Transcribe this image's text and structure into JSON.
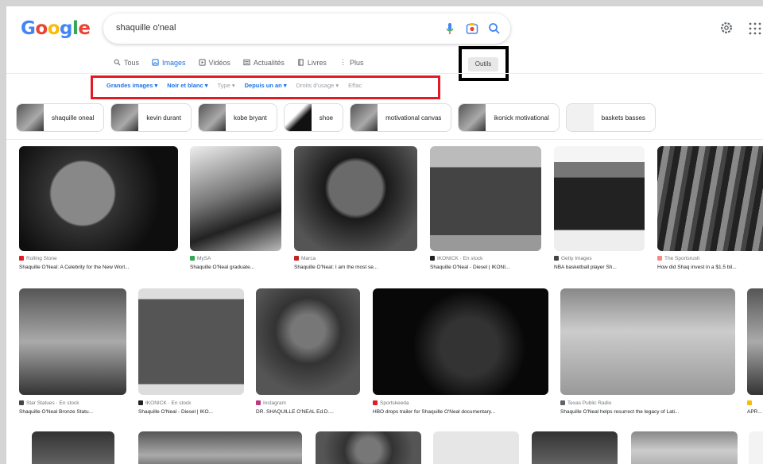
{
  "search": {
    "query": "shaquille o'neal"
  },
  "tabs": [
    {
      "label": "Tous",
      "icon": "search-icon",
      "active": false
    },
    {
      "label": "Images",
      "icon": "image-icon",
      "active": true
    },
    {
      "label": "Vidéos",
      "icon": "video-icon",
      "active": false
    },
    {
      "label": "Actualités",
      "icon": "news-icon",
      "active": false
    },
    {
      "label": "Livres",
      "icon": "book-icon",
      "active": false
    },
    {
      "label": "Plus",
      "icon": "more-icon",
      "active": false
    }
  ],
  "tools_label": "Outils",
  "filters": [
    "Grandes images",
    "Noir et blanc",
    "Type",
    "Depuis un an",
    "Droits d'usage",
    "Effac"
  ],
  "chips": [
    "shaquille oneal",
    "kevin durant",
    "kobe bryant",
    "shoe",
    "motivational canvas",
    "ikonick motivational",
    "baskets basses"
  ],
  "results_row1": [
    {
      "source": "Rolling Stone",
      "title": "Shaquille O'Neal: A Celebrity for the New Worl..."
    },
    {
      "source": "MySA",
      "title": "Shaquille O'Neal graduate..."
    },
    {
      "source": "Marca",
      "title": "Shaquille O'Neal: I am the most se..."
    },
    {
      "source": "IKONICK · En stock",
      "title": "Shaquille O'Neal - Diesel | IKONI..."
    },
    {
      "source": "Getty Images",
      "title": "NBA basketball player Sh..."
    },
    {
      "source": "The Sportsrush",
      "title": "How did Shaq invest in a $1.5 bil..."
    }
  ],
  "results_row2": [
    {
      "source": "Star Statues · En stock",
      "title": "Shaquille O'Neal Bronze Statu..."
    },
    {
      "source": "IKONICK · En stock",
      "title": "Shaquille O'Neal - Diesel | IKO..."
    },
    {
      "source": "Instagram",
      "title": "DR. SHAQUILLE O'NEAL Ed.D...."
    },
    {
      "source": "Sportskeeda",
      "title": "HBO drops trailer for Shaquille O'Neal documentary..."
    },
    {
      "source": "Texas Public Radio",
      "title": "Shaquille O'Neal helps resurrect the legacy of Lati..."
    },
    {
      "source": "",
      "title": "APR..."
    }
  ],
  "colors": {
    "brand_blue": "#1a73e8",
    "highlight_red": "#e21b23",
    "highlight_black": "#000000"
  }
}
